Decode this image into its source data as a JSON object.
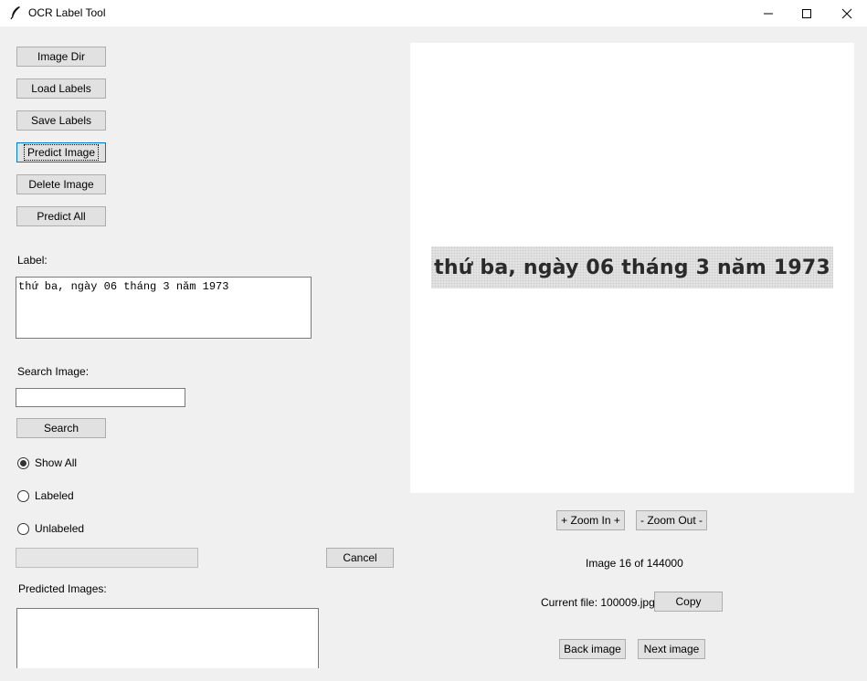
{
  "window": {
    "title": "OCR Label Tool",
    "controls": [
      "minimize",
      "maximize",
      "close"
    ]
  },
  "sidebar": {
    "buttons": {
      "image_dir": "Image Dir",
      "load_labels": "Load Labels",
      "save_labels": "Save Labels",
      "predict_image": "Predict Image",
      "delete_image": "Delete Image",
      "predict_all": "Predict All"
    },
    "label_heading": "Label:",
    "label_value": "thứ ba, ngày 06 tháng 3 năm 1973",
    "search_heading": "Search Image:",
    "search_value": "",
    "search_button": "Search",
    "filters": [
      {
        "label": "Show All",
        "checked": true
      },
      {
        "label": "Labeled",
        "checked": false
      },
      {
        "label": "Unlabeled",
        "checked": false
      }
    ],
    "progress_value": 0,
    "cancel_button": "Cancel",
    "predicted_heading": "Predicted Images:"
  },
  "viewer": {
    "image_text": "thứ ba, ngày 06 tháng 3 năm 1973",
    "zoom_in": "+ Zoom In +",
    "zoom_out": "- Zoom Out -",
    "image_counter": "Image 16 of 144000",
    "current_file": "Current file: 100009.jpg",
    "copy_button": "Copy",
    "back_button": "Back image",
    "next_button": "Next image"
  }
}
